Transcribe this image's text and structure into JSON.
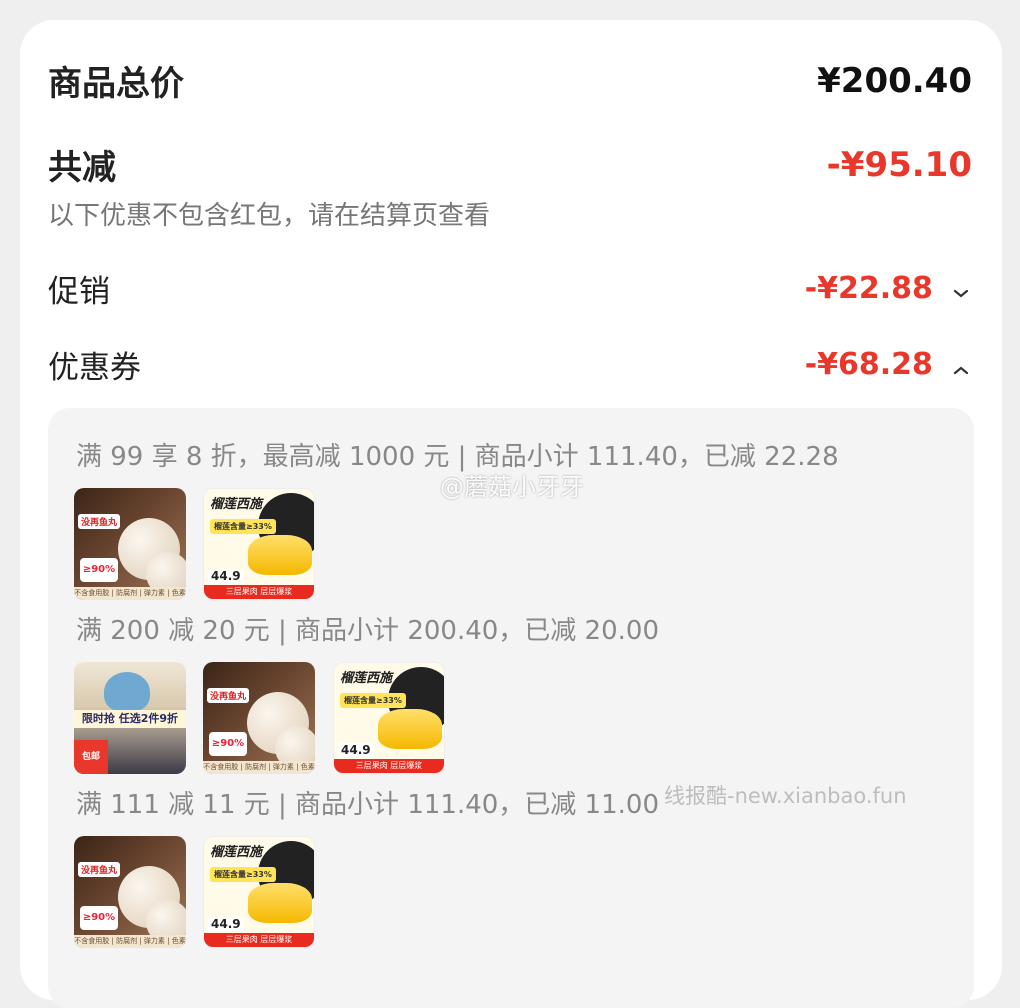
{
  "summary": {
    "total_label": "商品总价",
    "total_value": "¥200.40",
    "reduce_label": "共减",
    "reduce_value": "-¥95.10",
    "note": "以下优惠不包含红包，请在结算页查看",
    "promo_label": "促销",
    "promo_value": "-¥22.88",
    "coupon_label": "优惠券",
    "coupon_value": "-¥68.28"
  },
  "rules": [
    {
      "text": "满 99 享 8 折，最高减 1000 元 | 商品小计 111.40，已减 22.28"
    },
    {
      "text": "满 200 减 20 元 | 商品小计 200.40，已减 20.00"
    },
    {
      "text": "满 111 减 11 元 | 商品小计 111.40，已减 11.00"
    }
  ],
  "thumbs": {
    "ball_tag": "没再鱼丸",
    "ball_pct": "≥90%",
    "ball_foot": "不含食用胶 | 防腐剂 | 弹力素 | 色素",
    "durian_title": "榴莲西施",
    "durian_pill": "榴莲含量≥33%",
    "durian_price": "44.9",
    "durian_band": "三层果肉 层层爆浆",
    "mobile_strip": "限时抢 任选2件9折",
    "mobile_bag": "包邮"
  },
  "watermarks": {
    "weibo": "@蘑菇小牙牙",
    "site": "线报酷-new.xianbao.fun"
  },
  "colors": {
    "accent_red": "#e8372b"
  }
}
